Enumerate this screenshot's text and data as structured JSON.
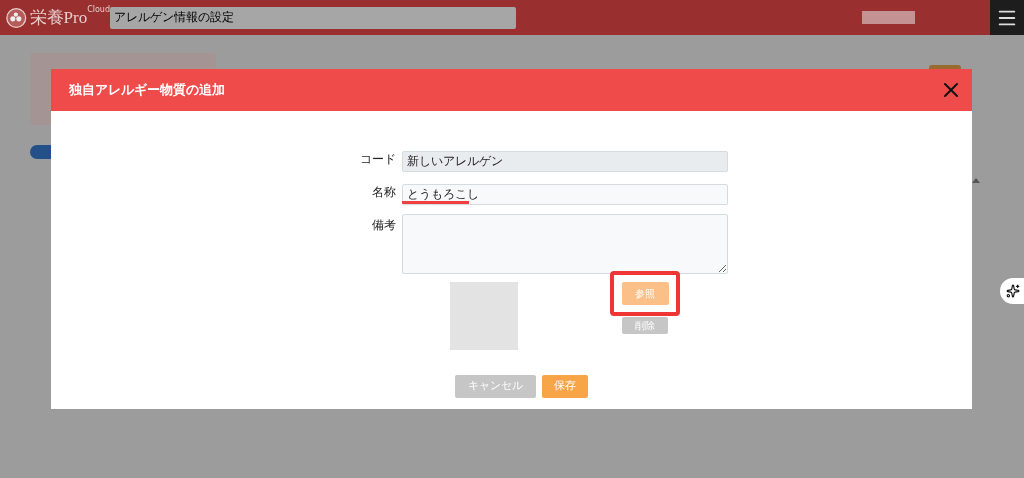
{
  "header": {
    "logo": "栄養Pro",
    "logo_sub": "Cloud",
    "search_value": "アレルゲン情報の設定"
  },
  "dialog": {
    "title": "独自アレルギー物質の追加",
    "fields": [
      {
        "kind": "text",
        "label": "コード",
        "value": "新しいアレルゲン",
        "disabled": true
      },
      {
        "kind": "text",
        "label": "名称",
        "value": "とうもろこし",
        "disabled": false
      },
      {
        "kind": "textarea",
        "label": "備考",
        "disabled": false
      }
    ],
    "browse_button": "参照",
    "delete_button": "削除",
    "cancel_button": "キャンセル",
    "save_button": "保存"
  }
}
